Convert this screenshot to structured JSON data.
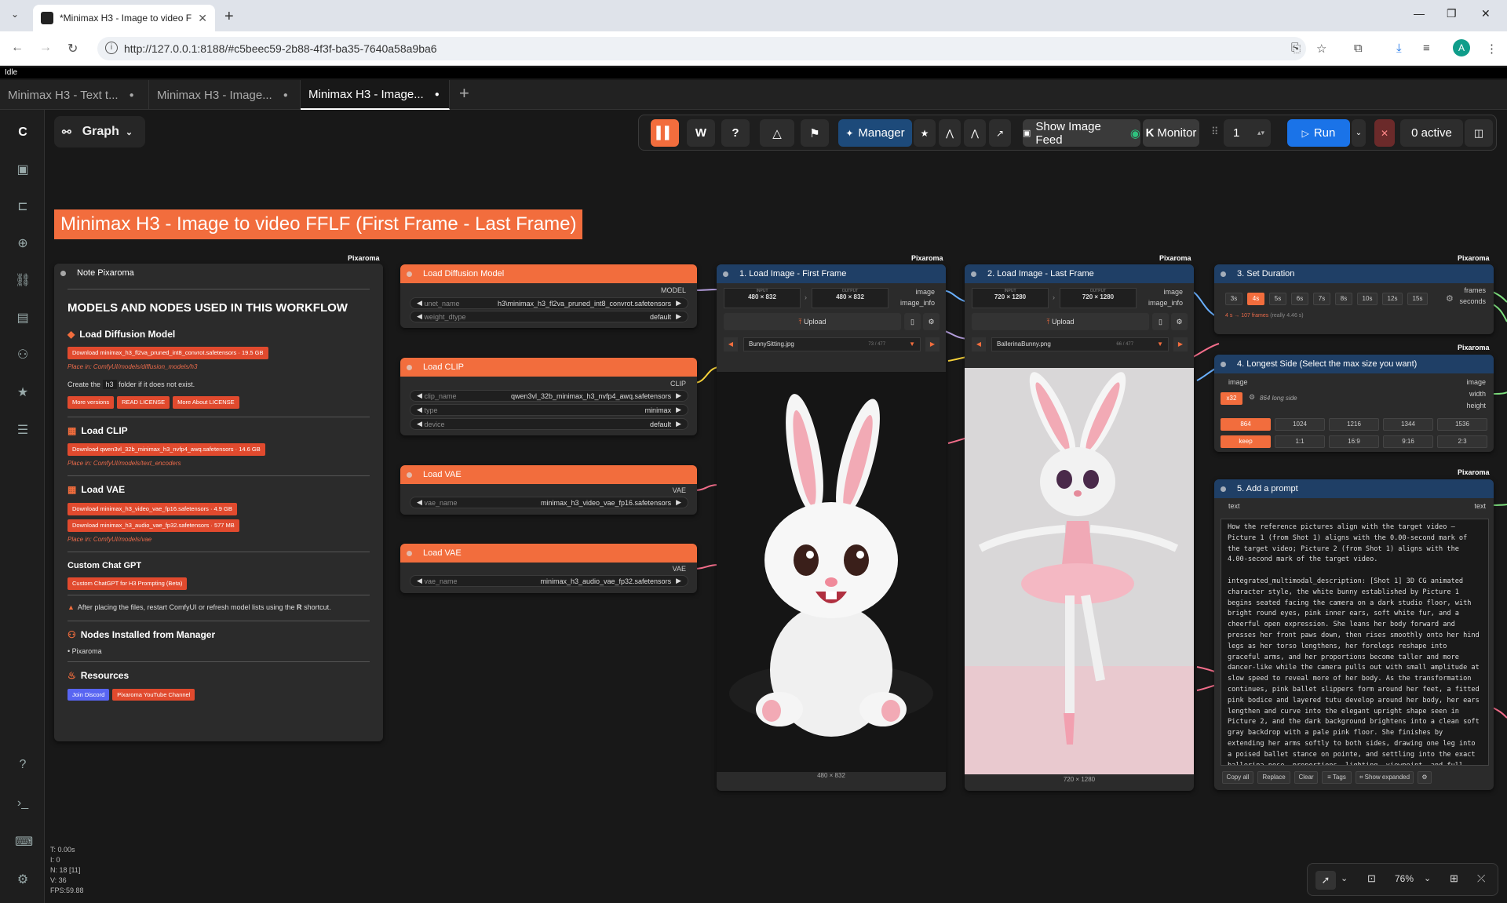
{
  "browser": {
    "tab_title": "*Minimax H3 - Image to video F",
    "url": "http://127.0.0.1:8188/#c5beec59-2b88-4f3f-ba35-7640a58a9ba6",
    "avatar_letter": "A"
  },
  "status": "Idle",
  "workflow_tabs": [
    {
      "label": "Minimax H3 - Text t..."
    },
    {
      "label": "Minimax H3 - Image..."
    },
    {
      "label": "Minimax H3 - Image..."
    }
  ],
  "toolbar": {
    "graph_label": "Graph",
    "manager_label": "Manager",
    "show_image_feed": "Show Image Feed",
    "monitor_label": "Monitor",
    "monitor_key": "K",
    "run_count": "1",
    "run_label": "Run",
    "active_label": "0 active",
    "w_label": "W",
    "help_label": "?"
  },
  "page_title": "Minimax H3 - Image to video FFLF (First Frame - Last Frame)",
  "brand": "Pixaroma",
  "note": {
    "title": "Note Pixaroma",
    "heading": "MODELS AND NODES USED IN THIS WORKFLOW",
    "diffusion": {
      "title": "Load Diffusion Model",
      "download": "Download minimax_h3_fl2va_pruned_int8_convrot.safetensors",
      "size": "19.5 GB",
      "place": "Place in: ComfyUI/models/diffusion_models/h3",
      "create": "Create the",
      "create_folder": "h3",
      "create_end": "folder if it does not exist.",
      "btn_more": "More versions",
      "btn_license": "READ LICENSE",
      "btn_about": "More About LICENSE"
    },
    "clip": {
      "title": "Load CLIP",
      "download": "Download qwen3vl_32b_minimax_h3_nvfp4_awq.safetensors",
      "size": "14.6 GB",
      "place": "Place in: ComfyUI/models/text_encoders"
    },
    "vae": {
      "title": "Load VAE",
      "download1": "Download minimax_h3_video_vae_fp16.safetensors",
      "size1": "4.9 GB",
      "download2": "Download minimax_h3_audio_vae_fp32.safetensors",
      "size2": "577 MB",
      "place": "Place in: ComfyUI/models/vae"
    },
    "chat": {
      "title": "Custom Chat GPT",
      "btn": "Custom ChatGPT for H3 Prompting (Beta)"
    },
    "warning_pre": "After placing the files, restart ComfyUI or refresh model lists using the",
    "warning_key": "R",
    "warning_post": "shortcut.",
    "installed_title": "Nodes Installed from Manager",
    "installed_item": "Pixaroma",
    "resources_title": "Resources",
    "btn_discord": "Join Discord",
    "btn_youtube": "Pixaroma YouTube Channel"
  },
  "nodes": {
    "diffusion": {
      "title": "Load Diffusion Model",
      "out": "MODEL",
      "w1_label": "unet_name",
      "w1_value": "h3\\minimax_h3_fl2va_pruned_int8_convrot.safetensors",
      "w2_label": "weight_dtype",
      "w2_value": "default"
    },
    "clip": {
      "title": "Load CLIP",
      "out": "CLIP",
      "w1_label": "clip_name",
      "w1_value": "qwen3vl_32b_minimax_h3_nvfp4_awq.safetensors",
      "w2_label": "type",
      "w2_value": "minimax",
      "w3_label": "device",
      "w3_value": "default"
    },
    "vae1": {
      "title": "Load VAE",
      "out": "VAE",
      "w1_label": "vae_name",
      "w1_value": "minimax_h3_video_vae_fp16.safetensors"
    },
    "vae2": {
      "title": "Load VAE",
      "out": "VAE",
      "w1_label": "vae_name",
      "w1_value": "minimax_h3_audio_vae_fp32.safetensors"
    },
    "img1": {
      "title": "1. Load Image - First Frame",
      "input_label": "INPUT",
      "input_size": "480 × 832",
      "output_label": "OUTPUT",
      "output_size": "480 × 832",
      "out1": "image",
      "out2": "image_info",
      "upload": "Upload",
      "file": "BunnySitting.jpg",
      "counter": "73 / 477",
      "caption": "480 × 832"
    },
    "img2": {
      "title": "2. Load Image - Last Frame",
      "input_label": "INPUT",
      "input_size": "720 × 1280",
      "output_label": "OUTPUT",
      "output_size": "720 × 1280",
      "out1": "image",
      "out2": "image_info",
      "upload": "Upload",
      "file": "BallerinaBunny.png",
      "counter": "66 / 477",
      "caption": "720 × 1280"
    },
    "duration": {
      "title": "3. Set Duration",
      "chips": [
        "3s",
        "4s",
        "5s",
        "6s",
        "7s",
        "8s",
        "10s",
        "12s",
        "15s"
      ],
      "selected": "4s",
      "info": "4 s → 107 frames",
      "info2": "(really 4.46 s)",
      "out1": "frames",
      "out2": "seconds"
    },
    "longest": {
      "title": "4. Longest Side (Select the max size you want)",
      "in": "image",
      "mult": "x32",
      "long": "864 long side",
      "out1": "image",
      "out2": "width",
      "out3": "height",
      "sizes": [
        "864",
        "1024",
        "1216",
        "1344",
        "1536"
      ],
      "ratios": [
        "keep",
        "1:1",
        "16:9",
        "9:16",
        "2:3"
      ]
    },
    "prompt": {
      "title": "5. Add a prompt",
      "in": "text",
      "out": "text",
      "text": "How the reference pictures align with the target video — Picture 1 (from Shot 1) aligns with the 0.00-second mark of the target video; Picture 2 (from Shot 1) aligns with the 4.00-second mark of the target video.\n\nintegrated_multimodal_description: [Shot 1] 3D CG animated character style, the white bunny established by Picture 1 begins seated facing the camera on a dark studio floor, with bright round eyes, pink inner ears, soft white fur, and a cheerful open expression. She leans her body forward and presses her front paws down, then rises smoothly onto her hind legs as her torso lengthens, her forelegs reshape into graceful arms, and her proportions become taller and more dancer-like while the camera pulls out with small amplitude at slow speed to reveal more of her body. As the transformation continues, pink ballet slippers form around her feet, a fitted pink bodice and layered tutu develop around her body, her ears lengthen and curve into the elegant upright shape seen in Picture 2, and the dark background brightens into a clean soft gray backdrop with a pale pink floor. She finishes by extending her arms softly to both sides, drawing one leg into a poised ballet stance on pointe, and settling into the exact ballerina pose, proportions, lighting, viewpoint, and full-",
      "btn_copy": "Copy all",
      "btn_replace": "Replace",
      "btn_clear": "Clear",
      "btn_tags": "Tags",
      "btn_expanded": "Show expanded"
    }
  },
  "stats": {
    "t": "T: 0.00s",
    "i": "I: 0",
    "n": "N: 18 [11]",
    "v": "V: 36",
    "fps": "FPS:59.88"
  },
  "zoom": "76%"
}
